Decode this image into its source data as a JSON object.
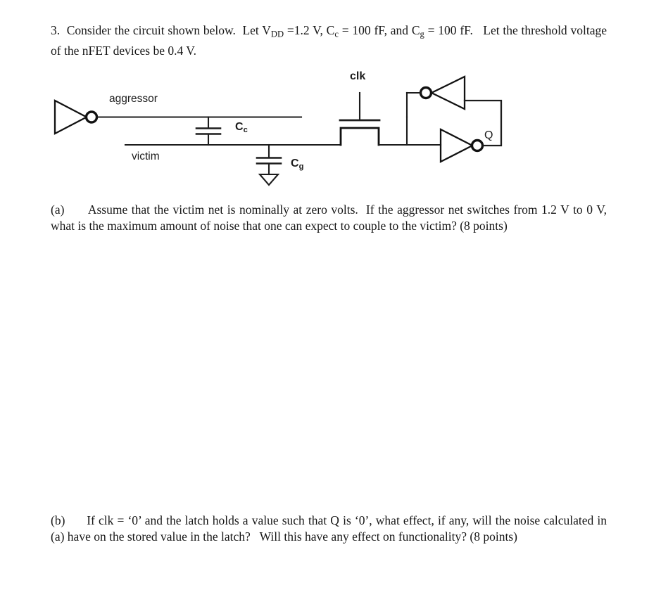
{
  "document": {
    "problem_number": "3.",
    "stem": {
      "line_1_pre": "3.  Consider the circuit shown below.  Let V",
      "vdd_sub": "DD",
      "line_1_mid": " =1.2 V, C",
      "cc_sub": "c",
      "line_1_mid2": " = 100 fF, and C",
      "cg_sub": "g",
      "line_1_post": " = 100 fF.   Let the threshold voltage of the nFET devices be 0.4 V.",
      "full_text": "3.  Consider the circuit shown below.  Let VDD =1.2 V, Cc = 100 fF, and Cg = 100 fF.   Let the threshold voltage of the nFET devices be 0.4 V."
    },
    "parts": [
      {
        "label": "(a)",
        "text": "Assume that the victim net is nominally at zero volts.  If the aggressor net switches from 1.2 V to 0 V, what is the maximum amount of noise that one can expect to couple to the victim? (8 points)",
        "points": "8 points"
      },
      {
        "label": "(b)",
        "text": "If clk = ‘0’ and the latch holds a value such that Q is ‘0’, what effect, if any, will the noise calculated in (a) have on the stored value in the latch?   Will this have any effect on functionality? (8 points)",
        "points": "8 points"
      }
    ]
  },
  "figure": {
    "labels": {
      "aggressor": "aggressor",
      "victim": "victim",
      "cc": "C",
      "cc_sub": "c",
      "cg": "C",
      "cg_sub": "g",
      "clk": "clk",
      "q": "Q"
    },
    "components": [
      "driver-inverter",
      "aggressor-net",
      "victim-net",
      "coupling-capacitor-Cc",
      "ground-capacitor-Cg",
      "ground-symbol",
      "nfet-pass-transistor",
      "feedback-inverter",
      "forward-inverter",
      "latch-feedback-wire"
    ],
    "colors": {
      "wire": "#1c1c1c",
      "device": "#111111",
      "label": "#1c1c1c"
    }
  }
}
